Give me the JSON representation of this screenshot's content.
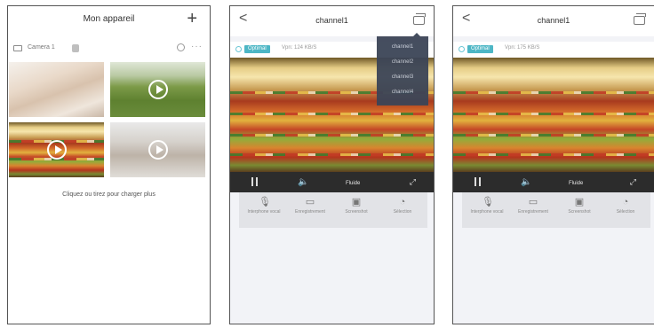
{
  "screen1": {
    "title": "Mon appareil",
    "add_symbol": "+",
    "camera": {
      "name": "Camera 1",
      "badge": "",
      "more": "···"
    },
    "load_more": "Cliquez ou tirez pour charger plus"
  },
  "screen2": {
    "back_symbol": "<",
    "title": "channel1",
    "info": {
      "badge": "Optimal",
      "rate": "Vpn: 124 KB/S"
    },
    "controls": {
      "quality": "Fluide",
      "speaker": "🔈",
      "expand": "⤢"
    },
    "dropdown": [
      "channel1",
      "channel2",
      "channel3",
      "channel4"
    ],
    "actions": [
      {
        "label": "Interphone vocal",
        "icon": "🎙"
      },
      {
        "label": "Enregistrement",
        "icon": "▭"
      },
      {
        "label": "Screenshot",
        "icon": "▣"
      },
      {
        "label": "Sélection",
        "icon": "◔"
      }
    ]
  },
  "screen3": {
    "back_symbol": "<",
    "title": "channel1",
    "info": {
      "badge": "Optimal",
      "rate": "Vpn: 175 KB/S"
    },
    "controls": {
      "quality": "Fluide",
      "speaker": "🔈",
      "expand": "⤢"
    },
    "actions": [
      {
        "label": "Interphone vocal",
        "icon": "🎙"
      },
      {
        "label": "Enregistrement",
        "icon": "▭"
      },
      {
        "label": "Screenshot",
        "icon": "▣"
      },
      {
        "label": "Sélection",
        "icon": "◔"
      }
    ]
  },
  "colors": {
    "accent": "#4db6c5",
    "control_bar": "#2c2c2c",
    "dropdown": "#3c4557",
    "page_bg": "#f2f3f7"
  }
}
